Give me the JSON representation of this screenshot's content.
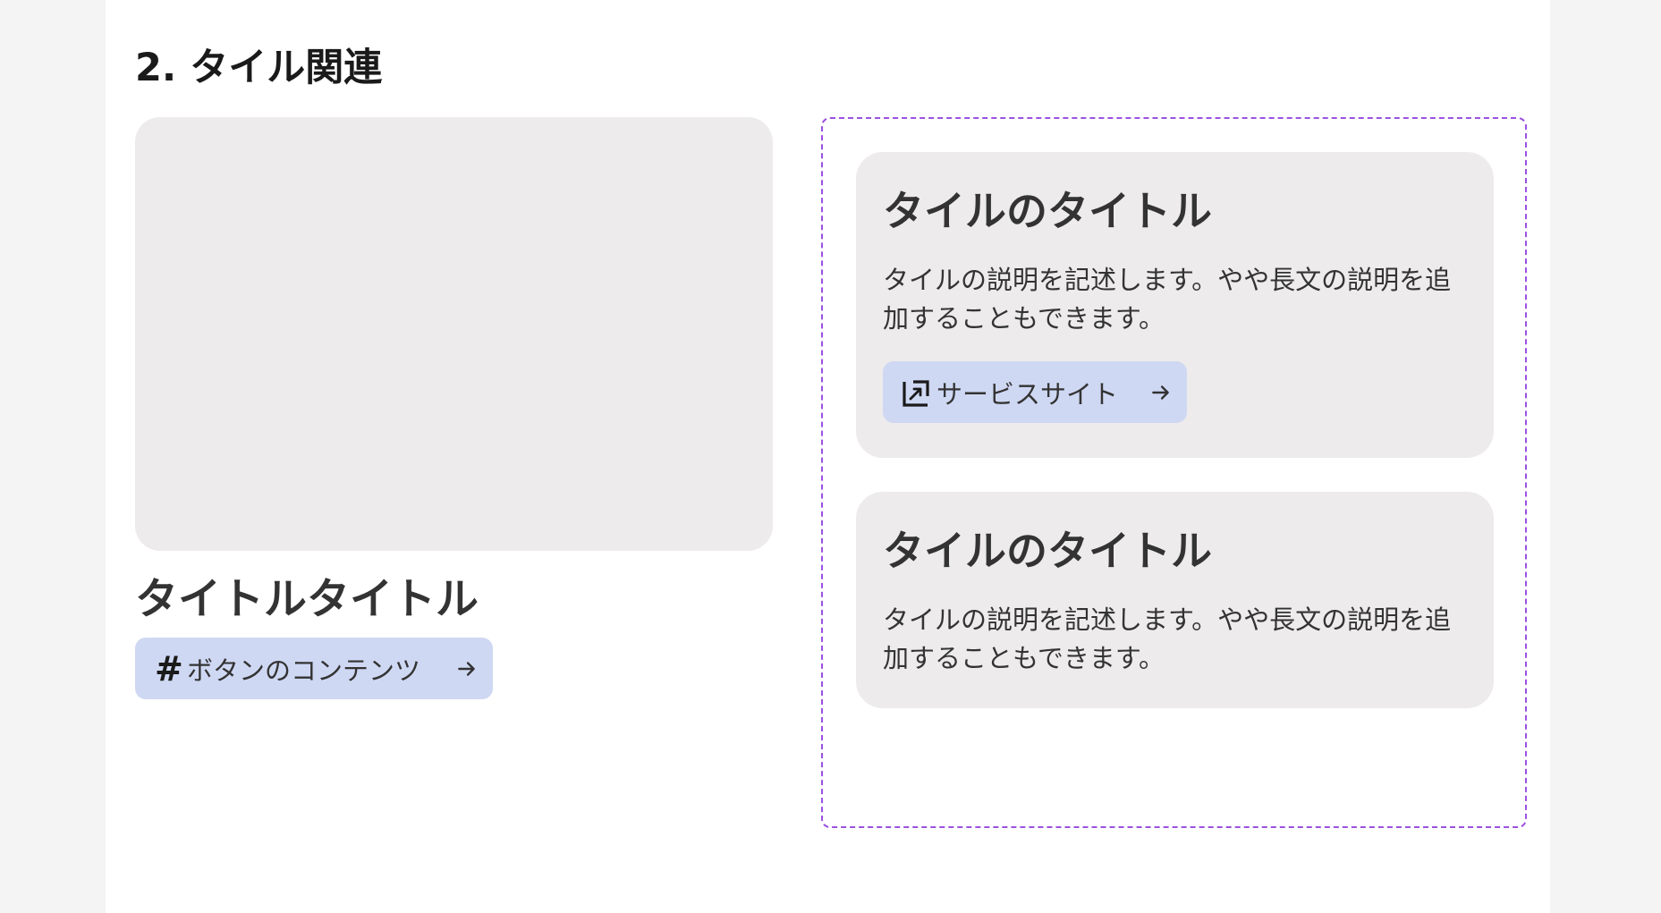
{
  "section": {
    "heading": "2. タイル関連"
  },
  "left_card": {
    "title": "タイトルタイトル",
    "button_icon": "hash-icon",
    "button_label": "ボタンのコンテンツ",
    "button_trailing_icon": "arrow-right-icon"
  },
  "tiles": [
    {
      "title": "タイルのタイトル",
      "description": "タイルの説明を記述します。やや長文の説明を追加することもできます。",
      "button_icon": "external-link-icon",
      "button_label": "サービスサイト",
      "button_trailing_icon": "arrow-right-icon"
    },
    {
      "title": "タイルのタイトル",
      "description": "タイルの説明を記述します。やや長文の説明を追加することもできます。"
    }
  ],
  "colors": {
    "page_background": "#f4f4f4",
    "content_background": "#ffffff",
    "tile_background": "#edebeb",
    "button_background": "#cfd8f3",
    "frame_border": "#9b51e0",
    "text": "#333333"
  }
}
